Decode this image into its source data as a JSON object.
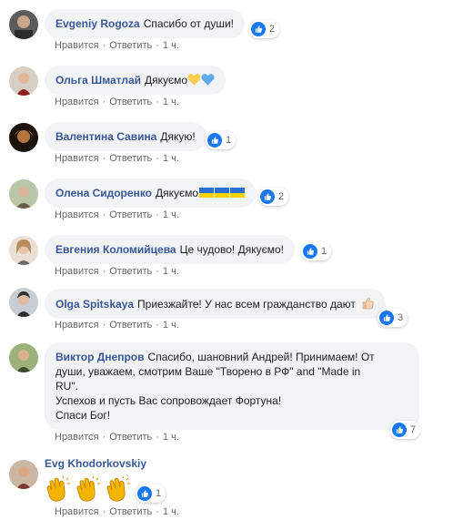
{
  "labels": {
    "like": "Нравится",
    "reply": "Ответить",
    "sep": "·"
  },
  "colors": {
    "author": "#385898",
    "bubble": "#f2f3f5",
    "like_blue": "#1877f2",
    "meta": "#65676b",
    "flag_blue": "#2a6fd6",
    "flag_yellow": "#f7d100"
  },
  "comments": [
    {
      "author": "Evgeniy Rogoza",
      "text": "Спасибо от души!",
      "reaction_icon": "like-icon",
      "reactions": "2",
      "time": "1 ч."
    },
    {
      "author": "Ольга Шматлай",
      "text": "Дякуємо",
      "emoji": [
        "yellow-heart-icon",
        "blue-heart-icon"
      ],
      "time": "1 ч."
    },
    {
      "author": "Валентина Савина",
      "text": "Дякую!",
      "reaction_icon": "like-icon",
      "reactions": "1",
      "time": "1 ч."
    },
    {
      "author": "Олена Сидоренко",
      "text": "Дякуємо",
      "emoji": [
        "ukraine-flag-icon",
        "ukraine-flag-icon",
        "ukraine-flag-icon"
      ],
      "reaction_icon": "like-icon",
      "reactions": "2",
      "time": "1 ч."
    },
    {
      "author": "Евгения Коломийцева",
      "text": "Це чудово! Дякуємо!",
      "reaction_icon": "like-icon",
      "reactions": "1",
      "time": "1 ч."
    },
    {
      "author": "Olga Spitskaya",
      "text": "Приезжайте! У нас всем гражданство дают",
      "emoji": [
        "thumbs-up-icon"
      ],
      "reaction_icon": "like-icon",
      "reactions": "3",
      "time": "1 ч."
    },
    {
      "author": "Виктор Днепров",
      "text_lines": [
        "Спасибо, шановний Андрей! Принимаем! От",
        "души, уважаем, смотрим Ваше \"Творено в РФ\" and \"Made in",
        "RU\".",
        "Успехов и пусть Вас сопровождает Фортуна!",
        "Спаси Бог!"
      ],
      "reaction_icon": "like-icon",
      "reactions": "7",
      "time": "1 ч."
    },
    {
      "author": "Evg Khodorkovskiy",
      "emoji": [
        "clapping-hands-icon",
        "clapping-hands-icon",
        "clapping-hands-icon"
      ],
      "reaction_icon": "like-icon",
      "reactions": "1",
      "time": "1 ч."
    }
  ]
}
